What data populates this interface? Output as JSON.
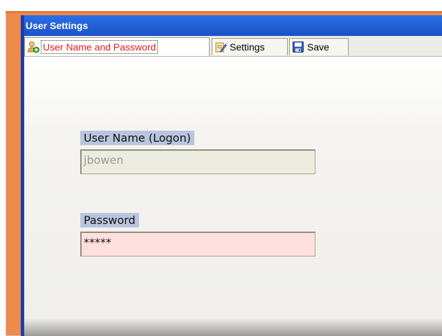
{
  "window": {
    "title": "User Settings"
  },
  "tabs": [
    {
      "label": "User Name and Password",
      "icon": "user-add-icon",
      "active": true
    },
    {
      "label": "Settings",
      "icon": "edit-settings-icon",
      "active": false
    },
    {
      "label": "Save",
      "icon": "save-disk-icon",
      "active": false
    }
  ],
  "form": {
    "username_label": "User Name (Logon)",
    "username_value": "jbowen",
    "password_label": "Password",
    "password_value": "*****"
  },
  "colors": {
    "frame": "#ee8a4a",
    "title_bar": "#1a52c8",
    "active_tab_text": "#e01b1b",
    "label_highlight": "#b9c5de",
    "password_bg": "#ffe0df"
  }
}
